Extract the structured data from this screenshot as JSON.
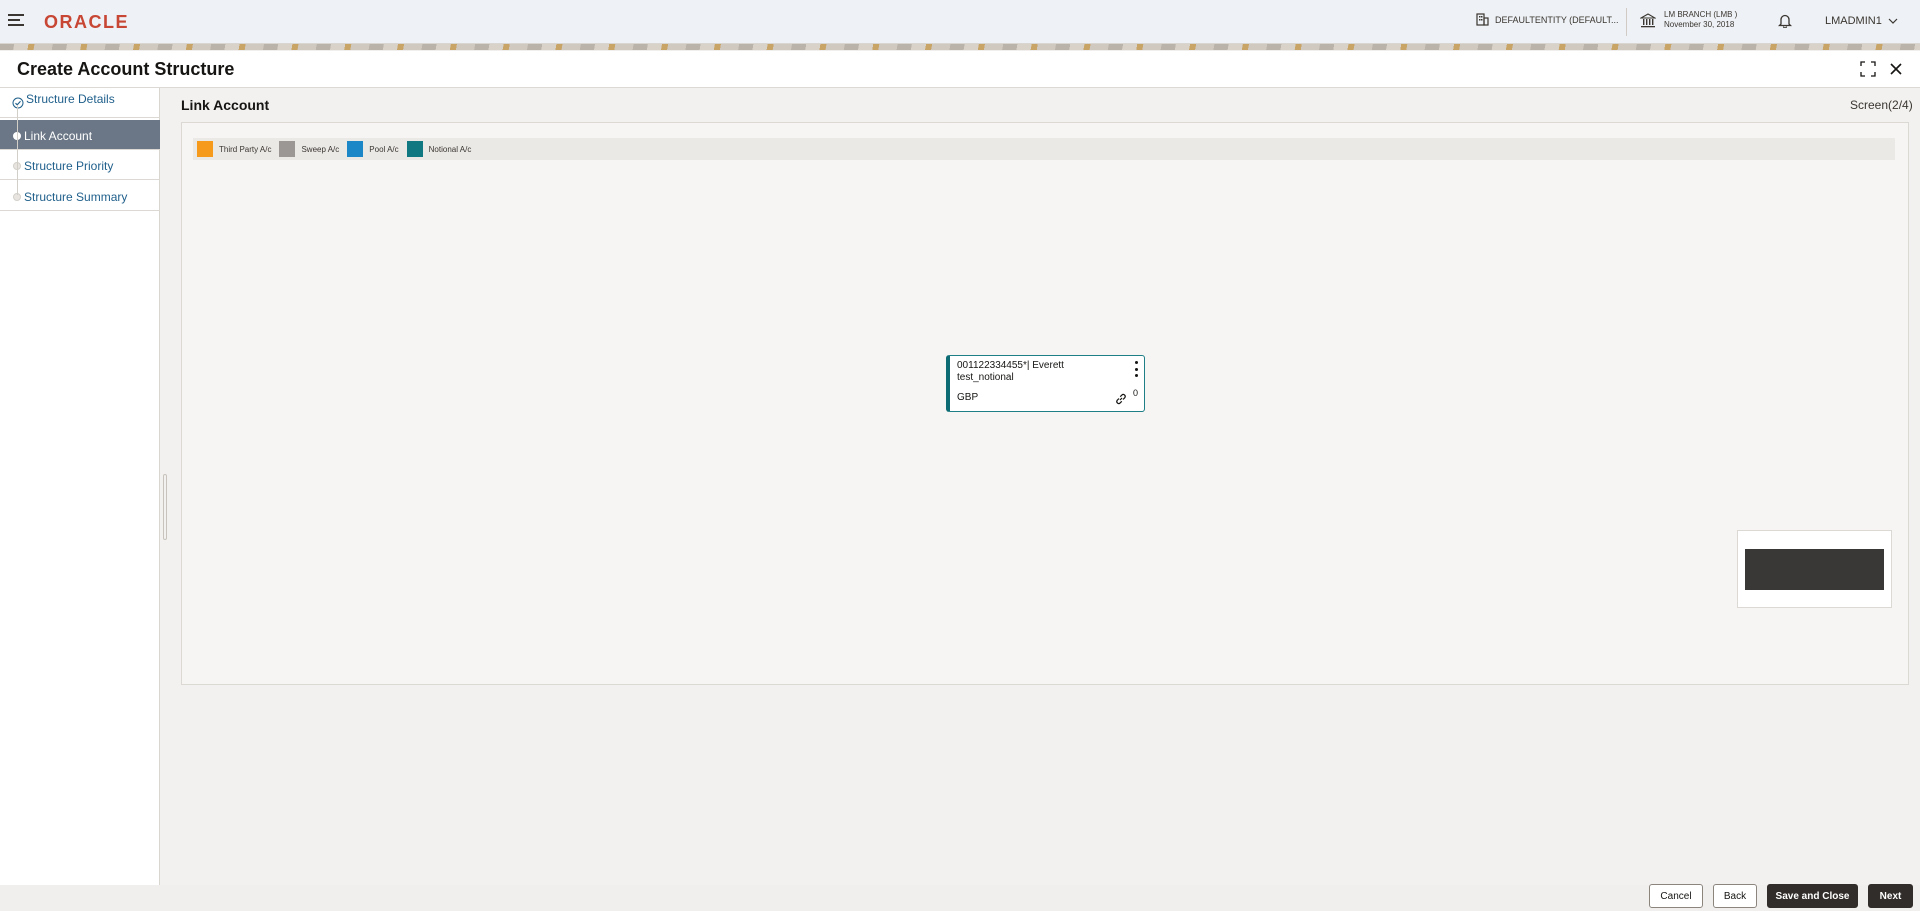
{
  "header": {
    "logo": "ORACLE",
    "entity": "DEFAULTENTITY (DEFAULT...",
    "branch_line1": "LM BRANCH (LMB )",
    "branch_line2": "November 30, 2018",
    "user": "LMADMIN1"
  },
  "page": {
    "title": "Create Account Structure"
  },
  "steps": [
    {
      "label": "Structure Details",
      "state": "completed"
    },
    {
      "label": "Link Account",
      "state": "active"
    },
    {
      "label": "Structure Priority",
      "state": "pending"
    },
    {
      "label": "Structure Summary",
      "state": "pending"
    }
  ],
  "section": {
    "title": "Link Account",
    "screen_count": "Screen(2/4)"
  },
  "legend": [
    {
      "label": "Third Party A/c",
      "color": "#f59a1b"
    },
    {
      "label": "Sweep A/c",
      "color": "#9a9795"
    },
    {
      "label": "Pool A/c",
      "color": "#1b87c7"
    },
    {
      "label": "Notional A/c",
      "color": "#0f7880"
    }
  ],
  "account_card": {
    "id_line": "001122334455*| Everett",
    "name": "test_notional",
    "currency": "GBP",
    "link_count": "0"
  },
  "footer": {
    "cancel": "Cancel",
    "back": "Back",
    "save_close": "Save and Close",
    "next": "Next"
  }
}
